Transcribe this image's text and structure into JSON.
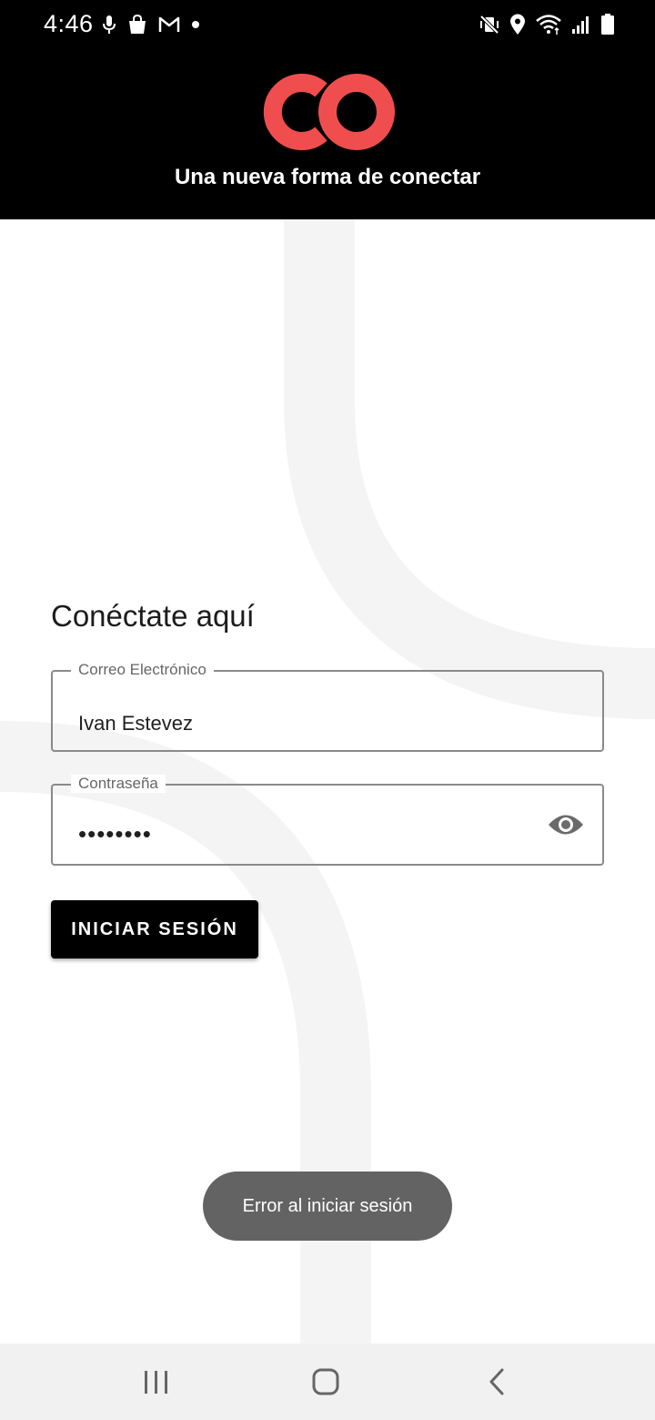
{
  "status_bar": {
    "time": "4:46",
    "left_icons": [
      "microphone-icon",
      "shopping-bag-icon",
      "gmail-icon",
      "dot-icon"
    ],
    "right_icons": [
      "vibrate-off-icon",
      "location-icon",
      "wifi-icon",
      "signal-icon",
      "battery-icon"
    ]
  },
  "header": {
    "logo_text": "CO",
    "tagline": "Una nueva forma de conectar",
    "background_color": "#000000",
    "logo_color": "#F04E4E"
  },
  "login": {
    "title": "Conéctate aquí",
    "email_label": "Correo Electrónico",
    "email_value": "Ivan Estevez",
    "password_label": "Contraseña",
    "password_value": "••••••••",
    "password_toggle_icon": "eye-icon",
    "submit_label": "INICIAR SESIÓN"
  },
  "toast": {
    "message": "Error al iniciar sesión"
  },
  "nav_bar": {
    "buttons": [
      "recents-icon",
      "home-icon",
      "back-icon"
    ]
  }
}
